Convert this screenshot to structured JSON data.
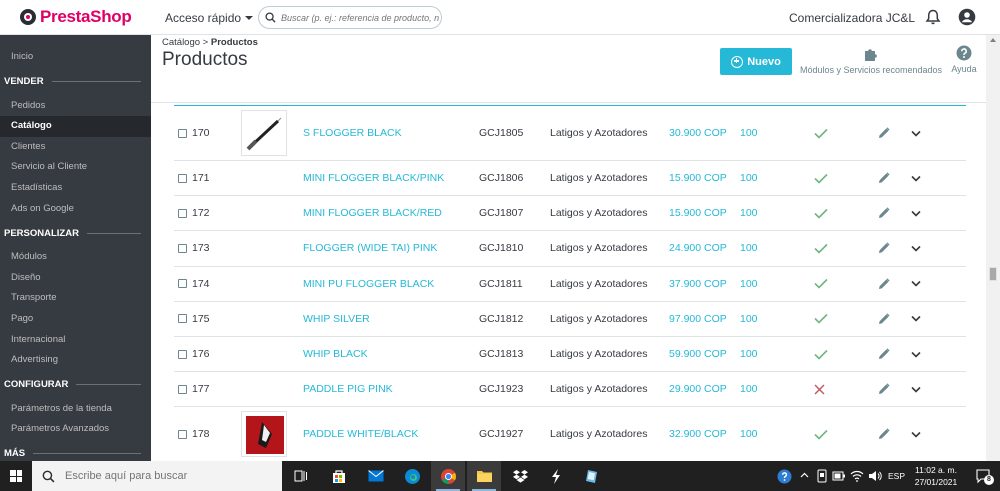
{
  "header": {
    "logo_text": "PrestaShop",
    "quick_access": "Acceso rápido",
    "search_placeholder": "Buscar (p. ej.: referencia de producto, n",
    "company": "Comercializadora JC&L"
  },
  "sidebar": {
    "items_top": [
      {
        "label": "Inicio"
      }
    ],
    "sections": [
      {
        "title": "VENDER",
        "items": [
          {
            "label": "Pedidos",
            "active": false
          },
          {
            "label": "Catálogo",
            "active": true
          },
          {
            "label": "Clientes",
            "active": false
          },
          {
            "label": "Servicio al Cliente",
            "active": false
          },
          {
            "label": "Estadísticas",
            "active": false
          },
          {
            "label": "Ads on Google",
            "active": false
          }
        ]
      },
      {
        "title": "PERSONALIZAR",
        "items": [
          {
            "label": "Módulos"
          },
          {
            "label": "Diseño"
          },
          {
            "label": "Transporte"
          },
          {
            "label": "Pago"
          },
          {
            "label": "Internacional"
          },
          {
            "label": "Advertising"
          }
        ]
      },
      {
        "title": "CONFIGURAR",
        "items": [
          {
            "label": "Parámetros de la tienda"
          },
          {
            "label": "Parámetros Avanzados"
          }
        ]
      },
      {
        "title": "MÁS",
        "items": []
      }
    ]
  },
  "page": {
    "breadcrumb_parent": "Catálogo",
    "breadcrumb_sep": ">",
    "breadcrumb_current": "Productos",
    "title": "Productos",
    "new_button": "Nuevo",
    "modules_label": "Módulos y Servicios recomendados",
    "help_label": "Ayuda"
  },
  "products": [
    {
      "id": "170",
      "name": "S FLOGGER BLACK",
      "ref": "GCJ1805",
      "category": "Latigos y Azotadores",
      "price": "30.900 COP",
      "qty": "100",
      "status": "enabled",
      "image": "whip"
    },
    {
      "id": "171",
      "name": "MINI FLOGGER BLACK/PINK",
      "ref": "GCJ1806",
      "category": "Latigos y Azotadores",
      "price": "15.900 COP",
      "qty": "100",
      "status": "enabled",
      "image": ""
    },
    {
      "id": "172",
      "name": "MINI FLOGGER BLACK/RED",
      "ref": "GCJ1807",
      "category": "Latigos y Azotadores",
      "price": "15.900 COP",
      "qty": "100",
      "status": "enabled",
      "image": ""
    },
    {
      "id": "173",
      "name": "FLOGGER (WIDE TAI) PINK",
      "ref": "GCJ1810",
      "category": "Latigos y Azotadores",
      "price": "24.900 COP",
      "qty": "100",
      "status": "enabled",
      "image": ""
    },
    {
      "id": "174",
      "name": "MINI PU FLOGGER BLACK",
      "ref": "GCJ1811",
      "category": "Latigos y Azotadores",
      "price": "37.900 COP",
      "qty": "100",
      "status": "enabled",
      "image": ""
    },
    {
      "id": "175",
      "name": "WHIP SILVER",
      "ref": "GCJ1812",
      "category": "Latigos y Azotadores",
      "price": "97.900 COP",
      "qty": "100",
      "status": "enabled",
      "image": ""
    },
    {
      "id": "176",
      "name": "WHIP BLACK",
      "ref": "GCJ1813",
      "category": "Latigos y Azotadores",
      "price": "59.900 COP",
      "qty": "100",
      "status": "enabled",
      "image": ""
    },
    {
      "id": "177",
      "name": "PADDLE PIG PINK",
      "ref": "GCJ1923",
      "category": "Latigos y Azotadores",
      "price": "29.900 COP",
      "qty": "100",
      "status": "disabled",
      "image": ""
    },
    {
      "id": "178",
      "name": "PADDLE WHITE/BLACK",
      "ref": "GCJ1927",
      "category": "Latigos y Azotadores",
      "price": "32.900 COP",
      "qty": "100",
      "status": "enabled",
      "image": "paddle"
    }
  ],
  "taskbar": {
    "search_placeholder": "Escribe aquí para buscar",
    "language": "ESP",
    "time": "11:02 a. m.",
    "date": "27/01/2021",
    "notification_count": "8",
    "apps": [
      "task-view",
      "store",
      "mail",
      "edge",
      "chrome",
      "file-explorer",
      "dropbox",
      "app-s",
      "notepad"
    ]
  },
  "colors": {
    "accent": "#25b9d7",
    "brand": "#df0067",
    "sidebar_bg": "#363a41",
    "enabled": "#70b580",
    "disabled": "#c05c67"
  }
}
